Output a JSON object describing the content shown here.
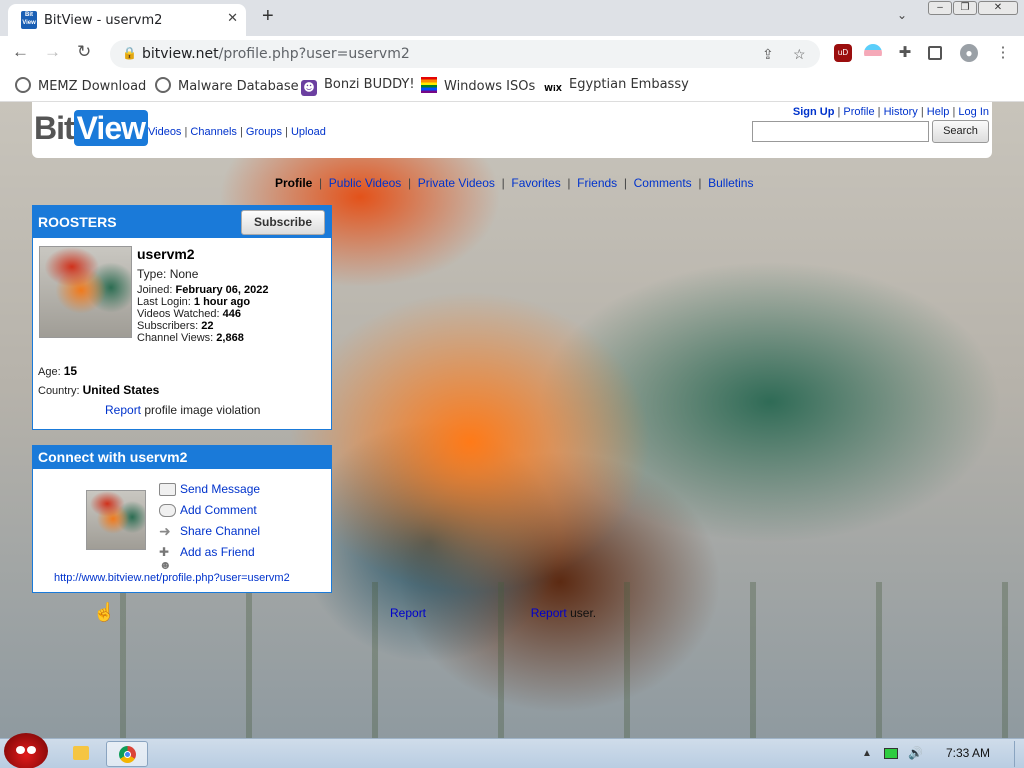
{
  "browser": {
    "tab_title": "BitView - uservm2",
    "favicon_text": "Bit View",
    "url_host": "bitview.net",
    "url_path": "/profile.php?user=uservm2",
    "bookmarks": [
      {
        "label": "MEMZ Download",
        "icon": "globe-icon"
      },
      {
        "label": "Malware Database",
        "icon": "globe-icon"
      },
      {
        "label": "Bonzi BUDDY!",
        "icon": "bonzi-icon"
      },
      {
        "label": "Windows ISOs",
        "icon": "windows-icon"
      },
      {
        "label": "Egyptian Embassy",
        "icon": "wix-icon"
      }
    ]
  },
  "site": {
    "logo_left": "Bit",
    "logo_right": "View",
    "nav": [
      "Videos",
      "Channels",
      "Groups",
      "Upload"
    ],
    "top_links": [
      "Sign Up",
      "Profile",
      "History",
      "Help",
      "Log In"
    ],
    "search_placeholder": "",
    "search_button": "Search"
  },
  "profile_nav": {
    "current": "Profile",
    "links": [
      "Public Videos",
      "Private Videos",
      "Favorites",
      "Friends",
      "Comments",
      "Bulletins"
    ]
  },
  "channel": {
    "name": "ROOSTERS",
    "subscribe_label": "Subscribe",
    "username": "uservm2",
    "type_label": "Type:",
    "type_value": "None",
    "joined_label": "Joined:",
    "joined_value": "February 06, 2022",
    "last_login_label": "Last Login:",
    "last_login_value": "1 hour ago",
    "watched_label": "Videos Watched:",
    "watched_value": "446",
    "subscribers_label": "Subscribers:",
    "subscribers_value": "22",
    "views_label": "Channel Views:",
    "views_value": "2,868",
    "age_label": "Age:",
    "age_value": "15",
    "country_label": "Country:",
    "country_value": "United States",
    "report_link": "Report",
    "report_text": "profile image violation"
  },
  "connect": {
    "title": "Connect with uservm2",
    "actions": [
      "Send Message",
      "Add Comment",
      "Share Channel",
      "Add as Friend"
    ],
    "profile_url": "http://www.bitview.net/profile.php?user=uservm2"
  },
  "footer_links": {
    "report1": "Report",
    "report2": "Report",
    "text2": "user."
  },
  "taskbar": {
    "clock": "7:33 AM"
  },
  "colors": {
    "accent": "#1a7ad9",
    "link": "#0033cc"
  }
}
